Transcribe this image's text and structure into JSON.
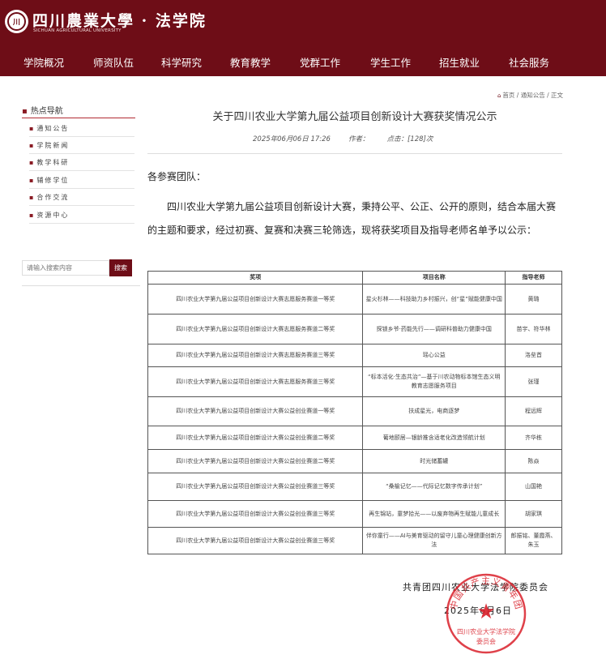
{
  "header": {
    "site_name": "四川農業大學 · 法学院",
    "site_sub": "SICHUAN AGRICULTURAL UNIVERSITY",
    "logo_text": "川",
    "nav": [
      "学院概况",
      "师资队伍",
      "科学研究",
      "教育教学",
      "党群工作",
      "学生工作",
      "招生就业",
      "社会服务"
    ]
  },
  "sidebar": {
    "title": "热点导航",
    "items": [
      "通知公告",
      "学院新闻",
      "教学科研",
      "辅修学位",
      "合作交流",
      "资源中心"
    ],
    "search_placeholder": "请输入搜索内容",
    "search_button": "搜索"
  },
  "breadcrumb": {
    "home": "首页",
    "sep1": " / ",
    "section": "通知公告",
    "sep2": " / ",
    "current": "正文"
  },
  "article": {
    "title": "关于四川农业大学第九届公益项目创新设计大赛获奖情况公示",
    "date": "2025年06月06日 17:26",
    "author_label": "作者：",
    "clicks": "点击：[128]次",
    "greeting": "各参赛团队：",
    "body": "四川农业大学第九届公益项目创新设计大赛，秉持公平、公正、公开的原则，结合本届大赛的主题和要求，经过初赛、复赛和决赛三轮筛选，现将获奖项目及指导老师名单予以公示：",
    "table": {
      "headers": [
        "奖项",
        "项目名称",
        "指导老师"
      ],
      "rows": [
        [
          "四川农业大学第九届公益项目创新设计大赛志愿服务赛道一等奖",
          "星火杉林——科技助力乡村振兴，创“星”赋能健康中国",
          "黄璐"
        ],
        [
          "四川农业大学第九届公益项目创新设计大赛志愿服务赛道二等奖",
          "探锁乡爷·药能先行——调研科普助力健康中国",
          "苗宇、符华林"
        ],
        [
          "四川农业大学第九届公益项目创新设计大赛志愿服务赛道三等奖",
          "瑶心公益",
          "洛垒首"
        ],
        [
          "四川农业大学第九届公益项目创新设计大赛志愿服务赛道三等奖",
          "“标本活化·生态共治”—基于川农动物标本馆生态义明教育志愿服务项目",
          "张瑾"
        ],
        [
          "四川农业大学第九届公益项目创新设计大赛公益创业赛道一等奖",
          "扶成星光，电商逐梦",
          "程远辉"
        ],
        [
          "四川农业大学第九届公益项目创新设计大赛公益创业赛道二等奖",
          "葡地颐居—银龄推含适老化改造领航计划",
          "齐华栋"
        ],
        [
          "四川农业大学第九届公益项目创新设计大赛公益创业赛道二等奖",
          "时光储蓄罐",
          "陈焱"
        ],
        [
          "四川农业大学第九届公益项目创新设计大赛公益创业赛道三等奖",
          "“桑榆记忆——代际记忆数字传承计划”",
          "山国艳"
        ],
        [
          "四川农业大学第九届公益项目创新设计大赛公益创业赛道三等奖",
          "再生锦站，童梦拾光——以废弃物再生赋能儿童成长",
          "胡家琪"
        ],
        [
          "四川农业大学第九届公益项目创新设计大赛公益创业赛道三等奖",
          "伴你童行——AI与美育驱动的留守儿童心理健康创新方法",
          "郎振铭、董霞燕、朱玉"
        ]
      ]
    },
    "sign_org": "共青团四川农业大学法学院委员会",
    "sign_date": "2025年6月6日",
    "seal_text": "中国共产主义青年团",
    "seal_bottom": "四川农业大学法学院",
    "seal_bottom2": "委员会"
  },
  "colors": {
    "brand": "#6e0d17",
    "seal": "#d9202a"
  }
}
